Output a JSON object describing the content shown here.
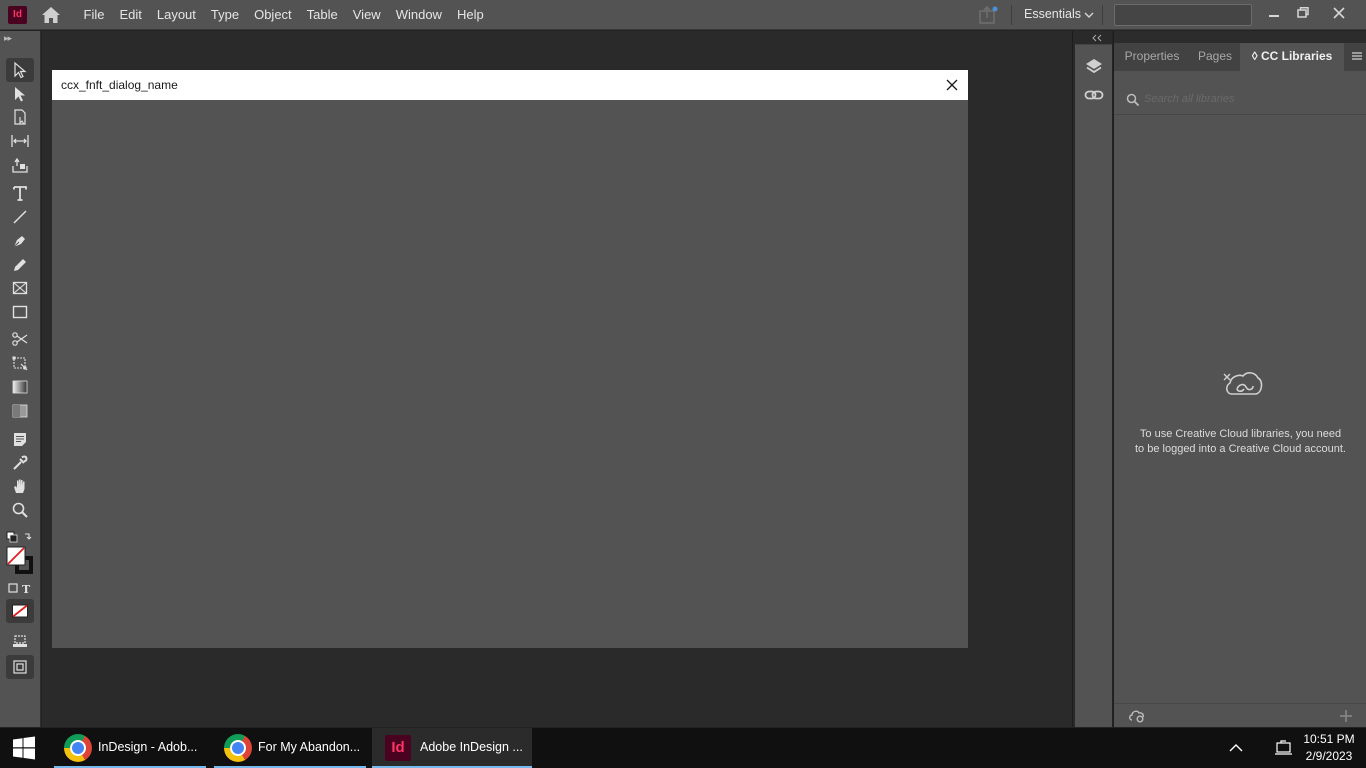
{
  "app": {
    "logo_text": "Id",
    "accent": "#ff3366"
  },
  "menubar": {
    "items": [
      "File",
      "Edit",
      "Layout",
      "Type",
      "Object",
      "Table",
      "View",
      "Window",
      "Help"
    ],
    "workspace_label": "Essentials",
    "search_value": ""
  },
  "dialog": {
    "title": "ccx_fnft_dialog_name"
  },
  "right_panel": {
    "tabs": [
      "Properties",
      "Pages",
      "CC Libraries"
    ],
    "active_tab": "CC Libraries",
    "cc_tab_prefix": "◊ ",
    "search_placeholder": "Search all libraries",
    "message": "To use Creative Cloud libraries, you need to be logged into a Creative Cloud account."
  },
  "taskbar": {
    "items": [
      {
        "label": "InDesign - Adob...",
        "icon": "chrome-icon"
      },
      {
        "label": "For My Abandon...",
        "icon": "chrome-icon"
      },
      {
        "label": "Adobe InDesign ...",
        "icon": "indesign-icon",
        "active": true
      }
    ],
    "time": "10:51 PM",
    "date": "2/9/2023",
    "indesign_icon_text": "Id"
  }
}
